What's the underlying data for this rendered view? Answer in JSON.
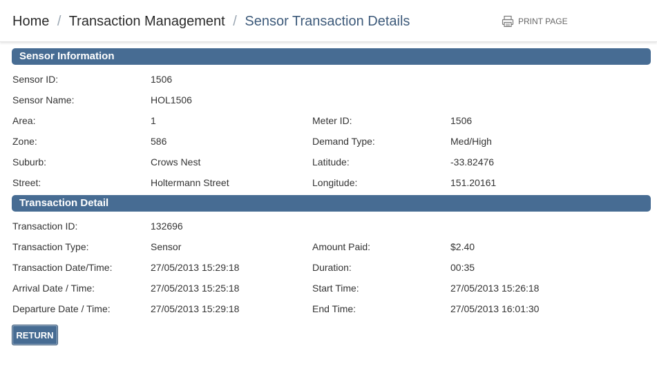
{
  "breadcrumb": {
    "items": [
      "Home",
      "Transaction Management",
      "Sensor Transaction Details"
    ],
    "separator": "/"
  },
  "print": {
    "label": "PRINT PAGE",
    "icon": "printer-icon"
  },
  "sensor_info": {
    "title": "Sensor Information",
    "sensor_id_label": "Sensor ID:",
    "sensor_id": "1506",
    "sensor_name_label": "Sensor Name:",
    "sensor_name": "HOL1506",
    "area_label": "Area:",
    "area": "1",
    "meter_id_label": "Meter ID:",
    "meter_id": "1506",
    "zone_label": "Zone:",
    "zone": "586",
    "demand_type_label": "Demand Type:",
    "demand_type": "Med/High",
    "suburb_label": "Suburb:",
    "suburb": "Crows Nest",
    "latitude_label": "Latitude:",
    "latitude": "-33.82476",
    "street_label": "Street:",
    "street": "Holtermann Street",
    "longitude_label": "Longitude:",
    "longitude": "151.20161"
  },
  "transaction_detail": {
    "title": "Transaction Detail",
    "transaction_id_label": "Transaction ID:",
    "transaction_id": "132696",
    "transaction_type_label": "Transaction Type:",
    "transaction_type": "Sensor",
    "amount_paid_label": "Amount Paid:",
    "amount_paid": "$2.40",
    "transaction_datetime_label": "Transaction Date/Time:",
    "transaction_datetime": "27/05/2013 15:29:18",
    "duration_label": "Duration:",
    "duration": "00:35",
    "arrival_label": "Arrival Date / Time:",
    "arrival": "27/05/2013 15:25:18",
    "start_time_label": "Start Time:",
    "start_time": "27/05/2013 15:26:18",
    "departure_label": "Departure Date / Time:",
    "departure": "27/05/2013 15:29:18",
    "end_time_label": "End Time:",
    "end_time": "27/05/2013 16:01:30"
  },
  "return_button": {
    "label": "RETURN"
  },
  "colors": {
    "section_bar": "#476c93",
    "breadcrumb_current": "#3d5a7a",
    "text": "#333333"
  }
}
